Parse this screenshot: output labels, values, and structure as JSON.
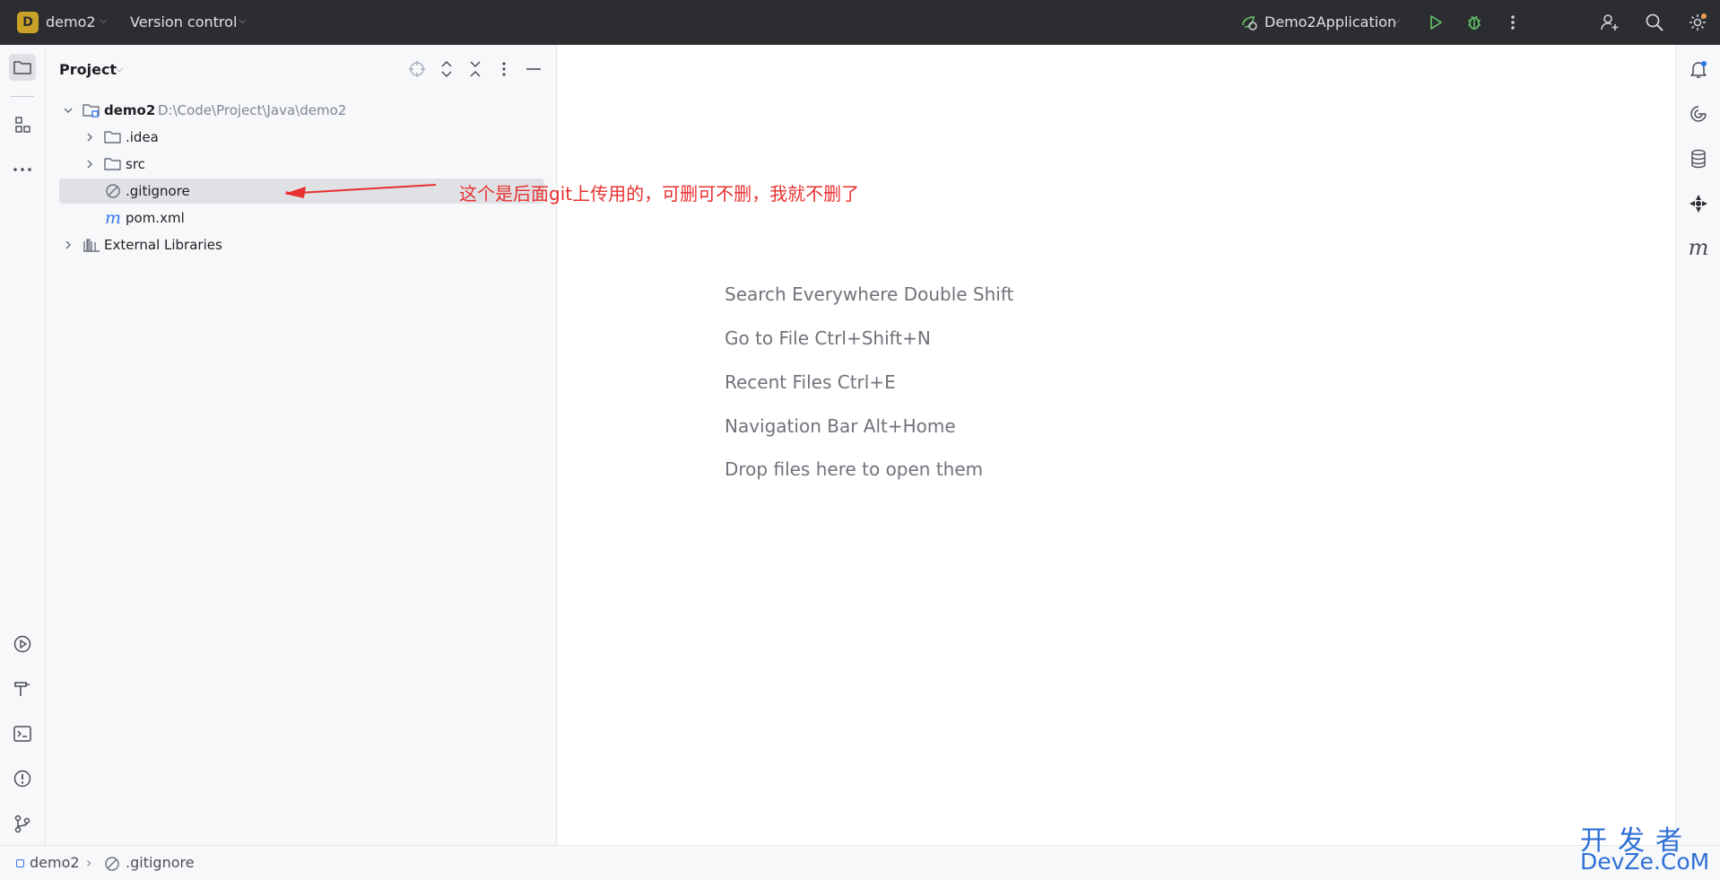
{
  "titlebar": {
    "project_badge": "D",
    "project_name": "demo2",
    "version_control": "Version control",
    "run_config": "Demo2Application",
    "icons": [
      "run-config-icon",
      "run-icon",
      "debug-icon",
      "more-icon",
      "add-user-icon",
      "search-icon",
      "settings-icon"
    ]
  },
  "left_strip": {
    "icons": [
      "project-folder-icon",
      "structure-icon",
      "more-tools-icon",
      "services-icon",
      "build-icon",
      "terminal-icon",
      "problems-icon",
      "git-icon"
    ]
  },
  "project_panel": {
    "title": "Project",
    "header_icons": [
      "locate-icon",
      "expand-all-icon",
      "collapse-all-icon",
      "options-icon",
      "hide-icon"
    ],
    "tree": {
      "root_name": "demo2",
      "root_path": "D:\\Code\\Project\\Java\\demo2",
      "idea": ".idea",
      "src": "src",
      "gitignore": ".gitignore",
      "pom": "pom.xml",
      "pom_icon": "m",
      "external": "External Libraries"
    },
    "annotation": "这个是后面git上传用的，可删可不删，我就不删了"
  },
  "editor": {
    "hints": [
      "Search Everywhere Double Shift",
      "Go to File Ctrl+Shift+N",
      "Recent Files Ctrl+E",
      "Navigation Bar Alt+Home",
      "Drop files here to open them"
    ]
  },
  "right_strip": {
    "icons": [
      "notifications-icon",
      "ai-assistant-icon",
      "database-icon",
      "plugin-icon",
      "maven-icon"
    ],
    "maven_label": "m"
  },
  "statusbar": {
    "breadcrumb_project": "demo2",
    "breadcrumb_file": ".gitignore"
  },
  "watermark": {
    "top": "开发者",
    "bottom": "DevZe.CoM"
  },
  "colors": {
    "titlebar_bg": "#2b2d30",
    "annotation": "#e8302f",
    "run_green": "#5fb865",
    "accent_blue": "#3574f0"
  }
}
